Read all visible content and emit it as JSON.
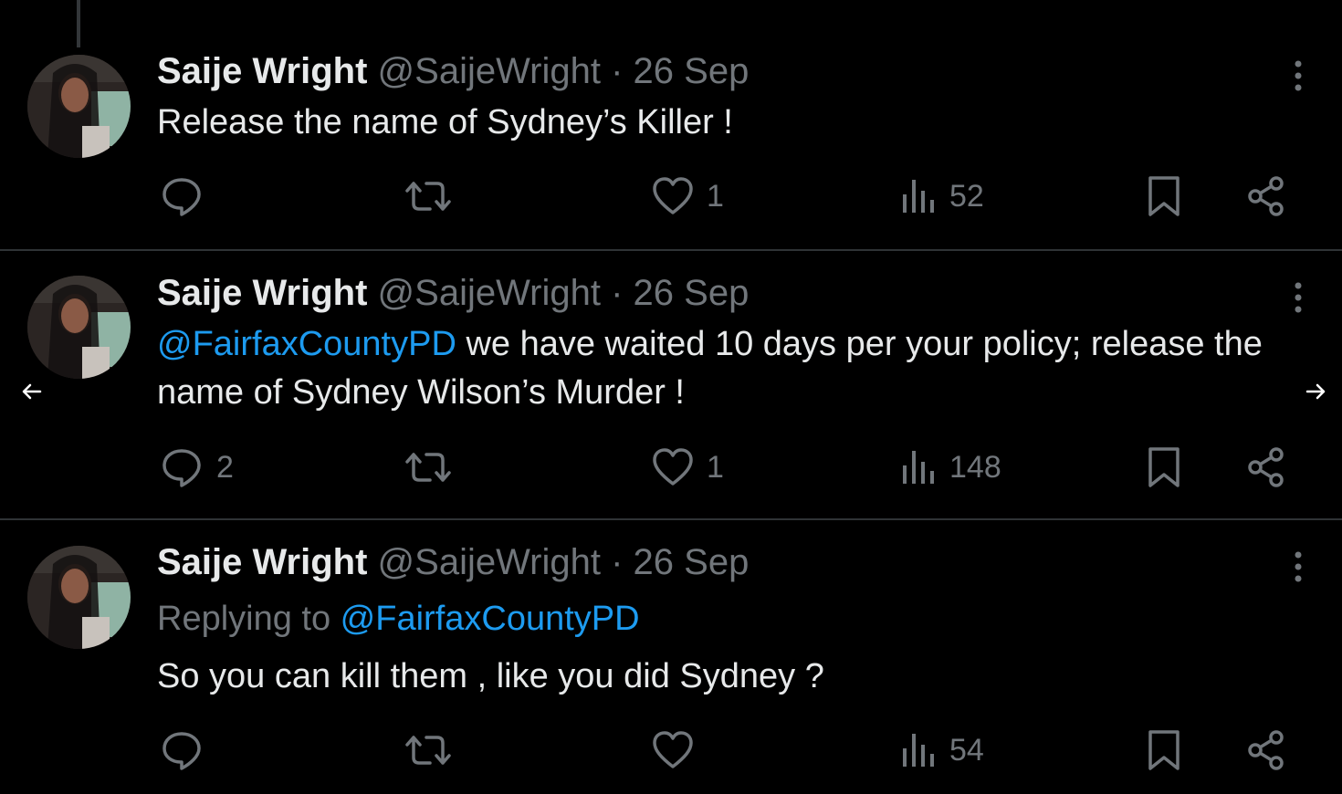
{
  "colors": {
    "background": "#000000",
    "text": "#e7e9ea",
    "muted": "#71767b",
    "link": "#1d9bf0",
    "divider": "#2f3336"
  },
  "tweets": [
    {
      "name": "Saije Wright",
      "handle": "@SaijeWright",
      "dot": "·",
      "date": "26 Sep",
      "text": "Release the name of Sydney’s Killer !",
      "stats": {
        "replies": "",
        "reposts": "",
        "likes": "1",
        "views": "52"
      }
    },
    {
      "name": "Saije Wright",
      "handle": "@SaijeWright",
      "dot": "·",
      "date": "26 Sep",
      "mention": "@FairfaxCountyPD",
      "text": " we have waited 10 days per your policy; release the name of Sydney Wilson’s Murder !",
      "stats": {
        "replies": "2",
        "reposts": "",
        "likes": "1",
        "views": "148"
      }
    },
    {
      "name": "Saije Wright",
      "handle": "@SaijeWright",
      "dot": "·",
      "date": "26 Sep",
      "replying_prefix": "Replying to ",
      "replying_to": "@FairfaxCountyPD",
      "text": "So you can kill them , like you did Sydney ?",
      "stats": {
        "replies": "",
        "reposts": "",
        "likes": "",
        "views": "54"
      }
    }
  ],
  "icons": {
    "avatar": "profile-photo",
    "more": "more-vertical-icon",
    "reply": "reply-icon",
    "repost": "repost-icon",
    "like": "heart-icon",
    "views": "views-bar-chart-icon",
    "bookmark": "bookmark-icon",
    "share": "share-icon",
    "prev": "arrow-left-icon",
    "next": "arrow-right-icon"
  }
}
